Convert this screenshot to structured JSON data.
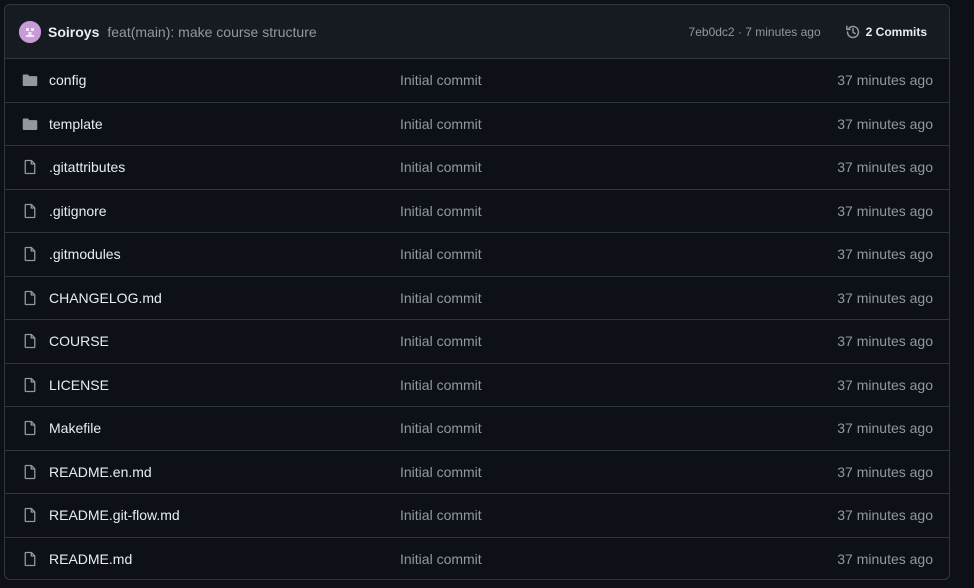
{
  "latest_commit": {
    "author": "Soiroys",
    "message": "feat(main): make course structure",
    "meta": "7eb0dc2 · 7 minutes ago",
    "commits_label": "2 Commits",
    "avatar_color": "#c89ad8"
  },
  "files": [
    {
      "name": "config",
      "type": "folder",
      "message": "Initial commit",
      "age": "37 minutes ago"
    },
    {
      "name": "template",
      "type": "folder",
      "message": "Initial commit",
      "age": "37 minutes ago"
    },
    {
      "name": ".gitattributes",
      "type": "file",
      "message": "Initial commit",
      "age": "37 minutes ago"
    },
    {
      "name": ".gitignore",
      "type": "file",
      "message": "Initial commit",
      "age": "37 minutes ago"
    },
    {
      "name": ".gitmodules",
      "type": "file",
      "message": "Initial commit",
      "age": "37 minutes ago"
    },
    {
      "name": "CHANGELOG.md",
      "type": "file",
      "message": "Initial commit",
      "age": "37 minutes ago"
    },
    {
      "name": "COURSE",
      "type": "file",
      "message": "Initial commit",
      "age": "37 minutes ago"
    },
    {
      "name": "LICENSE",
      "type": "file",
      "message": "Initial commit",
      "age": "37 minutes ago"
    },
    {
      "name": "Makefile",
      "type": "file",
      "message": "Initial commit",
      "age": "37 minutes ago"
    },
    {
      "name": "README.en.md",
      "type": "file",
      "message": "Initial commit",
      "age": "37 minutes ago"
    },
    {
      "name": "README.git-flow.md",
      "type": "file",
      "message": "Initial commit",
      "age": "37 minutes ago"
    },
    {
      "name": "README.md",
      "type": "file",
      "message": "Initial commit",
      "age": "37 minutes ago"
    }
  ]
}
